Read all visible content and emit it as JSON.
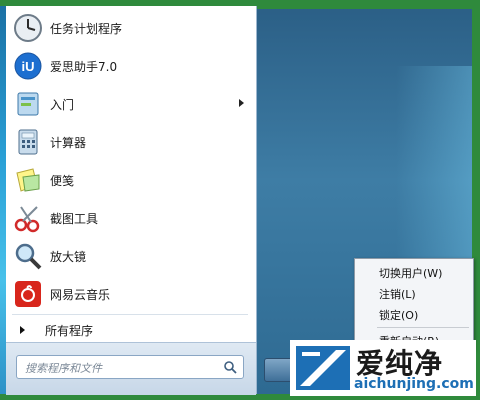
{
  "start_menu": {
    "items": [
      {
        "label": "任务计划程序",
        "icon": "clock-icon"
      },
      {
        "label": "爱思助手7.0",
        "icon": "aisi-assistant-icon"
      },
      {
        "label": "入门",
        "icon": "getting-started-icon",
        "has_submenu": true
      },
      {
        "label": "计算器",
        "icon": "calculator-icon"
      },
      {
        "label": "便笺",
        "icon": "sticky-notes-icon"
      },
      {
        "label": "截图工具",
        "icon": "scissors-icon"
      },
      {
        "label": "放大镜",
        "icon": "magnifier-icon"
      },
      {
        "label": "网易云音乐",
        "icon": "netease-music-icon"
      }
    ],
    "all_programs": "所有程序",
    "search_placeholder": "搜索程序和文件"
  },
  "shutdown_popup": {
    "items": [
      "切换用户(W)",
      "注销(L)",
      "锁定(O)",
      "重新启动(R)"
    ]
  },
  "watermark": {
    "text": "爱纯净",
    "url": "aichunjing.com"
  },
  "colors": {
    "frame_green": "#2f8a3c",
    "menu_white": "#ffffff",
    "brand_blue": "#1d6fb5"
  }
}
